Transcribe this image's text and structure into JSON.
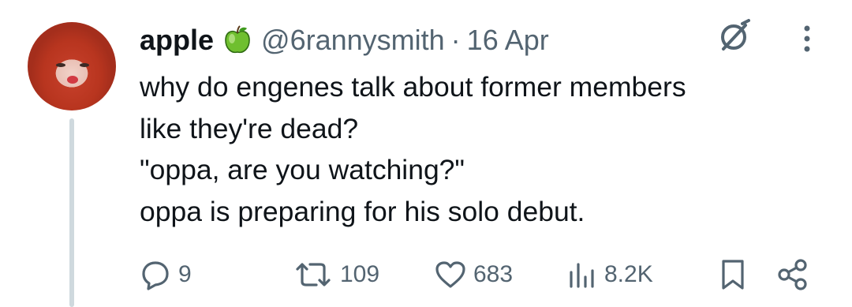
{
  "tweet": {
    "display_name": "apple",
    "handle": "@6rannysmith",
    "separator": "·",
    "date": "16 Apr",
    "lines": [
      "why do engenes talk about former members",
      "like they're dead?",
      "\"oppa, are you watching?\"",
      "oppa is preparing for his solo debut."
    ]
  },
  "actions": {
    "replies": "9",
    "retweets": "109",
    "likes": "683",
    "views": "8.2K"
  },
  "icons": {
    "badge": "green-apple-icon",
    "grok": "grok-icon",
    "more": "more-vertical-icon",
    "reply": "reply-icon",
    "retweet": "retweet-icon",
    "like": "heart-icon",
    "views": "views-chart-icon",
    "bookmark": "bookmark-icon",
    "share": "share-icon"
  },
  "colors": {
    "text": "#0f1419",
    "muted": "#536471",
    "thread_line": "#cfd9de",
    "apple_green": "#6fbf2f"
  }
}
